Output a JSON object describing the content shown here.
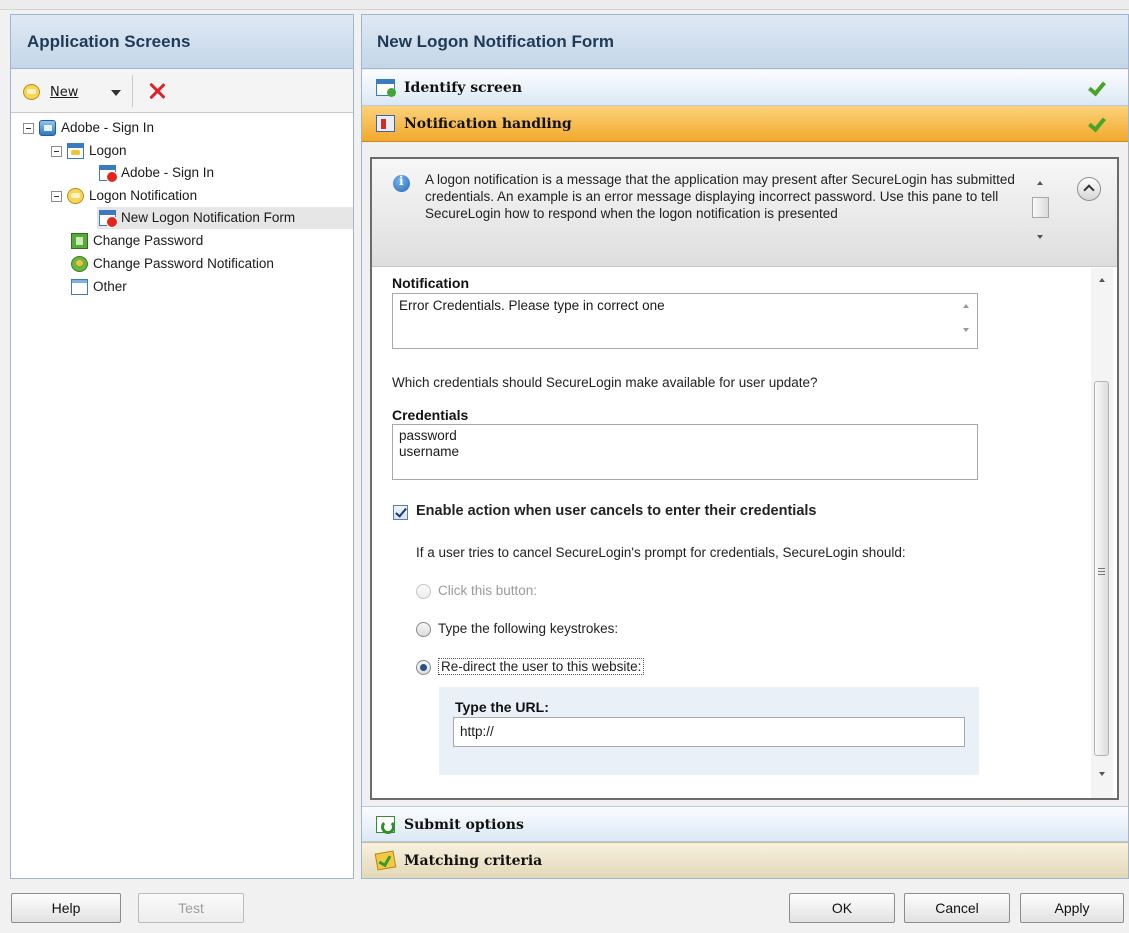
{
  "left_panel": {
    "title": "Application Screens",
    "toolbar": {
      "new_label": "New"
    },
    "tree": [
      {
        "label": "Adobe - Sign In",
        "icon": "application-icon"
      },
      {
        "label": "Logon",
        "icon": "logon-screen-icon"
      },
      {
        "label": "Adobe - Sign In",
        "icon": "screen-error-icon"
      },
      {
        "label": "Logon Notification",
        "icon": "notification-bubble-icon"
      },
      {
        "label": "New Logon Notification Form",
        "icon": "screen-error-icon",
        "selected": true
      },
      {
        "label": "Change Password",
        "icon": "change-password-icon"
      },
      {
        "label": "Change Password Notification",
        "icon": "change-password-notification-icon"
      },
      {
        "label": "Other",
        "icon": "other-screen-icon"
      }
    ]
  },
  "right_panel": {
    "title": "New Logon Notification Form",
    "sections": {
      "identify": "Identify screen",
      "notification": "Notification handling",
      "submit": "Submit options",
      "matching": "Matching criteria"
    },
    "info_text": "A logon notification is a message that the application may present after SecureLogin has submitted credentials. An example is an error message displaying incorrect password. Use this pane to tell SecureLogin how to respond when the logon notification is presented",
    "notification_label": "Notification",
    "notification_value": "Error Credentials. Please type in correct one",
    "credentials_question": "Which credentials should SecureLogin make available for user update?",
    "credentials_label": "Credentials",
    "credentials": [
      "password",
      "username"
    ],
    "enable_action_label": "Enable action when user cancels to enter their credentials",
    "enable_action_checked": true,
    "cancel_text": "If a user tries to cancel SecureLogin's prompt for credentials, SecureLogin should:",
    "options": {
      "click_button": "Click this button:",
      "type_keystrokes": "Type the following keystrokes:",
      "redirect": "Re-direct the user to this website:"
    },
    "selected_option": "redirect",
    "url_label": "Type the URL:",
    "url_value": "http://"
  },
  "buttons": {
    "help": "Help",
    "test": "Test",
    "ok": "OK",
    "cancel": "Cancel",
    "apply": "Apply"
  },
  "colors": {
    "header_blue": "#c4d6e8",
    "active_section_orange": "#f2a92b",
    "check_green": "#4ba428",
    "delete_red": "#d9262b"
  }
}
